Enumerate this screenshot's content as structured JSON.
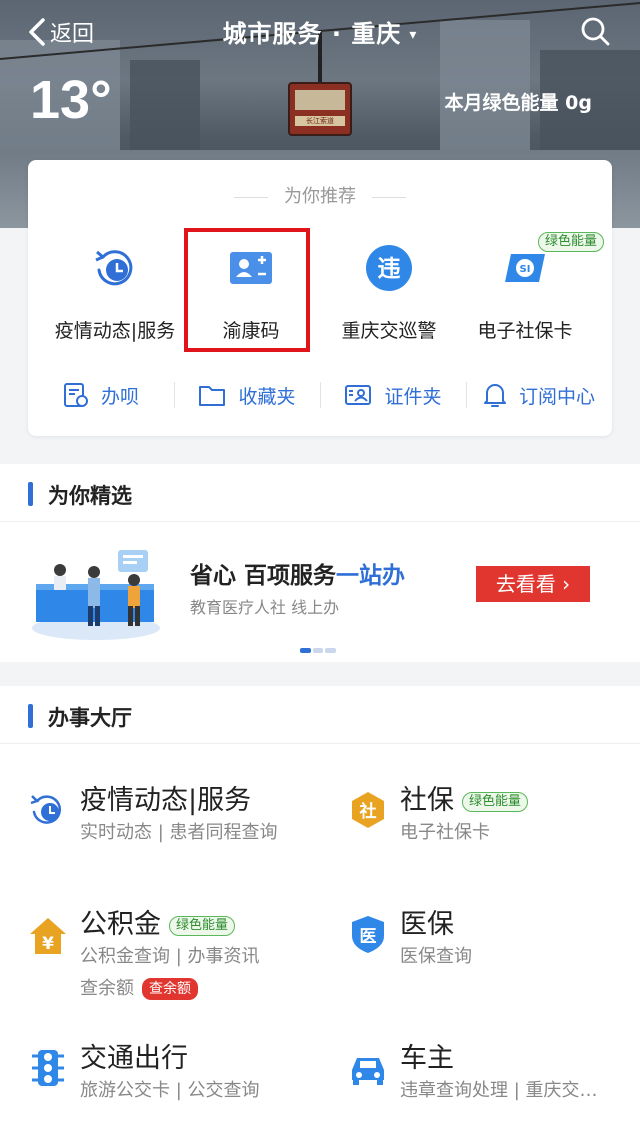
{
  "header": {
    "back_label": "返回",
    "title": "城市服务 · 重庆",
    "caret": "▾",
    "temperature": "13°",
    "energy_label": "本月绿色能量",
    "energy_value": "0g",
    "cabin_text": "长江索道"
  },
  "recommend": {
    "title": "为你推荐",
    "tiles": [
      {
        "label": "疫情动态|服务",
        "icon": "clock-refresh-icon"
      },
      {
        "label": "渝康码",
        "icon": "id-card-icon"
      },
      {
        "label": "重庆交巡警",
        "icon": "violation-icon",
        "icon_text": "违"
      },
      {
        "label": "电子社保卡",
        "icon": "social-security-card-icon",
        "icon_text": "SI",
        "tag": "绿色能量"
      }
    ],
    "tools": [
      {
        "label": "办呗",
        "icon": "doc-icon"
      },
      {
        "label": "收藏夹",
        "icon": "folder-icon"
      },
      {
        "label": "证件夹",
        "icon": "id-photo-icon"
      },
      {
        "label": "订阅中心",
        "icon": "bell-icon"
      }
    ]
  },
  "featured": {
    "title": "为你精选",
    "promo_main_a": "省心 百项服务",
    "promo_main_b": "一站办",
    "promo_sub": "教育医疗人社 线上办",
    "promo_button": "去看看 ›"
  },
  "hall": {
    "title": "办事大厅",
    "services": [
      {
        "name": "疫情动态|服务",
        "sub": "实时动态 | 患者同程查询",
        "icon": "clock-refresh-icon"
      },
      {
        "name": "社保",
        "tag": "绿色能量",
        "sub": "电子社保卡",
        "icon": "shebao-icon",
        "icon_text": "社"
      },
      {
        "name": "公积金",
        "tag": "绿色能量",
        "sub": "公积金查询 | 办事资讯",
        "sub2": "查余额",
        "sub2_tag": "查余额",
        "icon": "yuan-house-icon",
        "icon_text": "¥"
      },
      {
        "name": "医保",
        "sub": "医保查询",
        "icon": "medical-insurance-icon",
        "icon_text": "医"
      },
      {
        "name": "交通出行",
        "sub": "旅游公交卡 | 公交查询",
        "icon": "traffic-light-icon"
      },
      {
        "name": "车主",
        "sub": "违章查询处理 | 重庆交…",
        "icon": "car-icon"
      }
    ]
  },
  "colors": {
    "accent": "#2f6fd6",
    "red": "#e0362f",
    "green": "#59b85a"
  }
}
